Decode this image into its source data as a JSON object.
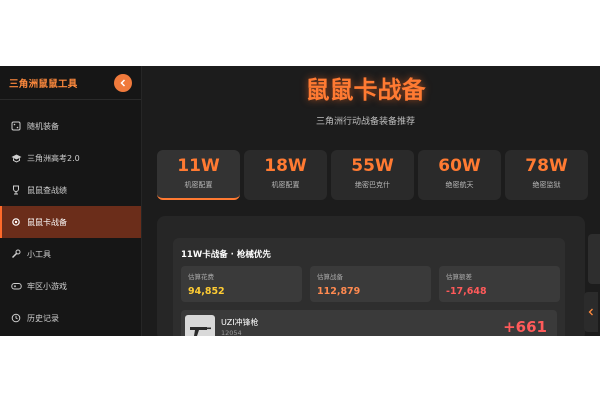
{
  "sidebar": {
    "title": "三角洲鼠鼠工具",
    "collapse_icon": "chevron-left-icon",
    "items": [
      {
        "label": "随机装备",
        "icon": "dice-icon"
      },
      {
        "label": "三角洲高考2.0",
        "icon": "graduation-cap-icon"
      },
      {
        "label": "鼠鼠查战绩",
        "icon": "trophy-icon"
      },
      {
        "label": "鼠鼠卡战备",
        "icon": "gear-icon"
      },
      {
        "label": "小工具",
        "icon": "wrench-icon"
      },
      {
        "label": "牢区小游戏",
        "icon": "gamepad-icon"
      },
      {
        "label": "历史记录",
        "icon": "history-icon"
      }
    ],
    "active_index": 3
  },
  "main": {
    "title": "鼠鼠卡战备",
    "subtitle": "三角洲行动战备装备推荐",
    "tiers": [
      {
        "price": "11W",
        "label": "机密配置"
      },
      {
        "price": "18W",
        "label": "机密配置"
      },
      {
        "price": "55W",
        "label": "绝密巴克什"
      },
      {
        "price": "60W",
        "label": "绝密航天"
      },
      {
        "price": "78W",
        "label": "绝密监狱"
      }
    ],
    "active_tier": 0,
    "loadout": {
      "title": "11W卡战备 · 枪械优先",
      "stats": [
        {
          "label": "估算花费",
          "value": "94,852"
        },
        {
          "label": "估算战备",
          "value": "112,879"
        },
        {
          "label": "估算额差",
          "value": "-17,648"
        }
      ],
      "weapon": {
        "name": "UZI冲锋枪",
        "code": "12054",
        "gain": "+661",
        "icon": "smg-icon"
      }
    }
  },
  "colors": {
    "accent": "#ff7a32",
    "active_bg": "#6b2d1a",
    "gold": "#ffcc33",
    "loss": "#ff5a5a"
  }
}
